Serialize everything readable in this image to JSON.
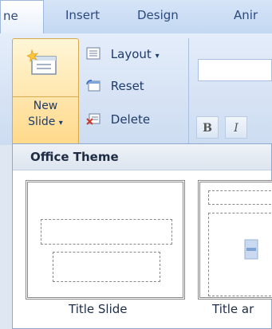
{
  "ribbon": {
    "tabs": [
      {
        "label": "ne",
        "active": true
      },
      {
        "label": "Insert",
        "active": false
      },
      {
        "label": "Design",
        "active": false
      },
      {
        "label": "Anir",
        "active": false
      }
    ]
  },
  "slides_group": {
    "new_slide_label_line1": "New",
    "new_slide_label_line2": "Slide",
    "new_slide_arrow": "▾",
    "commands": [
      {
        "label": "Layout",
        "arrow": "▾",
        "icon": "layout-icon"
      },
      {
        "label": "Reset",
        "icon": "reset-icon"
      },
      {
        "label": "Delete",
        "icon": "delete-icon"
      }
    ]
  },
  "font_group": {
    "bold_label": "B",
    "italic_label": "I"
  },
  "layout_gallery": {
    "header": "Office Theme",
    "items": [
      {
        "label": "Title Slide"
      },
      {
        "label": "Title ar"
      }
    ]
  },
  "colors": {
    "accent_hover": "#ffd98a",
    "text_blue": "#1f3b6a"
  }
}
